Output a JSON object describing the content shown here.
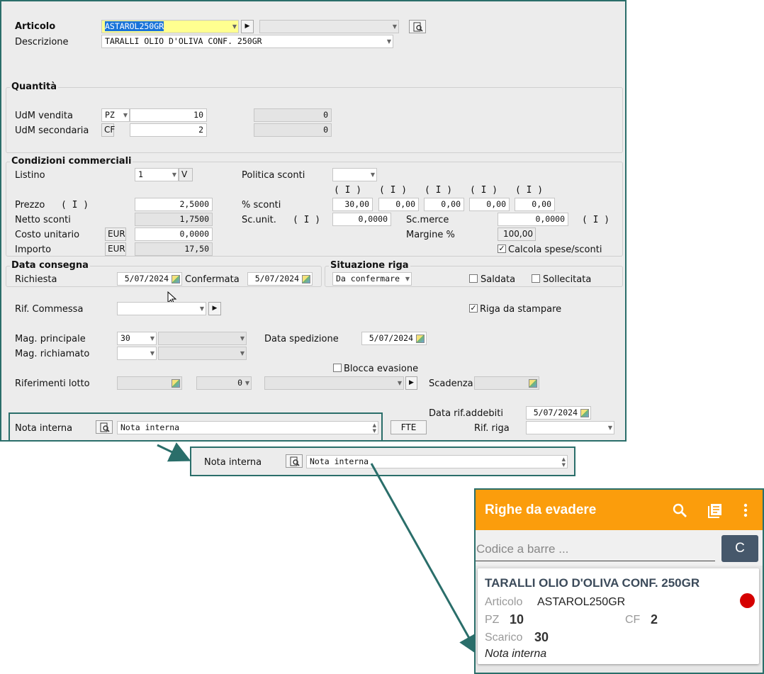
{
  "form": {
    "articolo_label": "Articolo",
    "articolo_value": "ASTAROL250GR",
    "descrizione_label": "Descrizione",
    "descrizione_value": "TARALLI OLIO D'OLIVA CONF. 250GR",
    "quantita_title": "Quantità",
    "udm_vendita_label": "UdM vendita",
    "udm_vendita_unit": "PZ",
    "udm_vendita_qty": "10",
    "udm_vendita_alt": "0",
    "udm_secondaria_label": "UdM secondaria",
    "udm_secondaria_unit": "CF",
    "udm_secondaria_qty": "2",
    "udm_secondaria_alt": "0",
    "condizioni_title": "Condizioni commerciali",
    "listino_label": "Listino",
    "listino_value": "1",
    "listino_tag": "V",
    "politica_label": "Politica sconti",
    "sconti_headers": [
      "( I )",
      "( I )",
      "( I )",
      "( I )",
      "( I )"
    ],
    "prezzo_label": "Prezzo",
    "prezzo_mark": "( I )",
    "prezzo_value": "2,5000",
    "sconti_label": "% sconti",
    "sconti_values": [
      "30,00",
      "0,00",
      "0,00",
      "0,00",
      "0,00"
    ],
    "netto_label": "Netto sconti",
    "netto_value": "1,7500",
    "scunit_label": "Sc.unit.",
    "scunit_mark": "( I )",
    "scunit_value": "0,0000",
    "scmerce_label": "Sc.merce",
    "scmerce_value": "0,0000",
    "scmerce_mark": "( I )",
    "costo_label": "Costo unitario",
    "costo_currency": "EUR",
    "costo_value": "0,0000",
    "margine_label": "Margine %",
    "margine_value": "100,00",
    "importo_label": "Importo",
    "importo_currency": "EUR",
    "importo_value": "17,50",
    "calcola_label": "Calcola spese/sconti",
    "data_consegna_title": "Data consegna",
    "richiesta_label": "Richiesta",
    "richiesta_value": "5/07/2024",
    "confermata_label": "Confermata",
    "confermata_value": "5/07/2024",
    "situazione_title": "Situazione riga",
    "situazione_value": "Da confermare",
    "saldata_label": "Saldata",
    "sollecitata_label": "Sollecitata",
    "rif_commessa_label": "Rif. Commessa",
    "riga_stampare_label": "Riga da stampare",
    "mag_principale_label": "Mag. principale",
    "mag_principale_value": "30",
    "mag_richiamato_label": "Mag. richiamato",
    "data_spedizione_label": "Data spedizione",
    "data_spedizione_value": "5/07/2024",
    "blocca_label": "Blocca evasione",
    "rif_lotto_label": "Riferimenti lotto",
    "lotto_num": "0",
    "scadenza_label": "Scadenza",
    "data_rif_label": "Data rif.addebiti",
    "data_rif_value": "5/07/2024",
    "nota_label": "Nota interna",
    "nota_value": "Nota interna",
    "fte_label": "FTE",
    "rif_riga_label": "Rif. riga"
  },
  "zoom": {
    "nota_label": "Nota interna",
    "nota_value": "Nota interna"
  },
  "mobile": {
    "title": "Righe da evadere",
    "barcode_placeholder": "Codice a barre ...",
    "c_button": "C",
    "card_title": "TARALLI OLIO D'OLIVA CONF. 250GR",
    "articolo_label": "Articolo",
    "articolo_value": "ASTAROL250GR",
    "pz_label": "PZ",
    "pz_value": "10",
    "cf_label": "CF",
    "cf_value": "2",
    "scarico_label": "Scarico",
    "scarico_value": "30",
    "nota": "Nota interna",
    "status_color": "#d50000",
    "accent_color": "#fb9d0c",
    "icons": [
      "search-icon",
      "list-icon",
      "more-vert-icon"
    ]
  },
  "colors": {
    "callout_border": "#2a6e6a",
    "selection": "#1a73d9"
  }
}
